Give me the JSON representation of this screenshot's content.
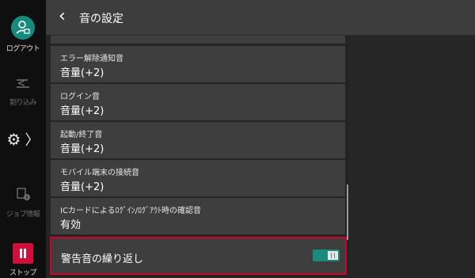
{
  "rail": {
    "logout_label": "ログアウト",
    "interrupt_label": "割り込み",
    "settings_chevron": "〉",
    "job_info_label": "ジョブ情報",
    "stop_label": "ストップ"
  },
  "header": {
    "back_glyph": "‹",
    "title": "音の設定"
  },
  "list": {
    "items": [
      {
        "label": "エラー解除通知音",
        "value": "音量(+2)"
      },
      {
        "label": "ログイン音",
        "value": "音量(+2)"
      },
      {
        "label": "起動/終了音",
        "value": "音量(+2)"
      },
      {
        "label": "モバイル端末の接続音",
        "value": "音量(+2)"
      },
      {
        "label": "ICカードによるﾛｸﾞｲﾝ/ﾛｸﾞｱｳﾄ時の確認音",
        "value": "有効"
      }
    ],
    "toggle_row": {
      "label": "警告音の繰り返し",
      "state": "on"
    }
  },
  "colors": {
    "accent": "#178a7e",
    "highlight_border": "#d2002a",
    "stop": "#d0103a"
  }
}
